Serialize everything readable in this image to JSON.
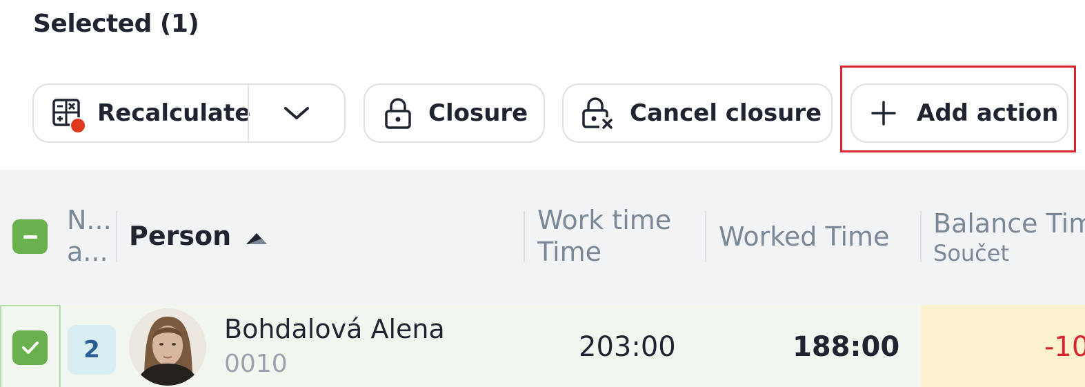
{
  "selection": {
    "title": "Selected (1)"
  },
  "toolbar": {
    "recalculate_label": "Recalculate",
    "closure_label": "Closure",
    "cancel_closure_label": "Cancel closure",
    "add_action_label": "Add action"
  },
  "table": {
    "columns": {
      "number_line1": "N...",
      "number_line2": "a...",
      "person": "Person",
      "work_time_line1": "Work time",
      "work_time_line2": "Time",
      "worked_time": "Worked Time",
      "balance_time": "Balance Tim",
      "balance_sub": "Součet"
    },
    "rows": [
      {
        "number": "2",
        "name": "Bohdalová Alena",
        "id": "0010",
        "work_time": "203:00",
        "worked_time": "188:00",
        "balance": "-10"
      }
    ]
  },
  "colors": {
    "accent_green": "#6ab04c",
    "highlight_red": "#d8252d",
    "balance_bg": "#fbf2cf",
    "notification_dot": "#e03a1e"
  },
  "icons": [
    "calculator-icon",
    "chevron-down-icon",
    "lock-icon",
    "lock-cancel-icon",
    "plus-icon",
    "sort-asc-icon",
    "check-icon",
    "minus-icon"
  ]
}
